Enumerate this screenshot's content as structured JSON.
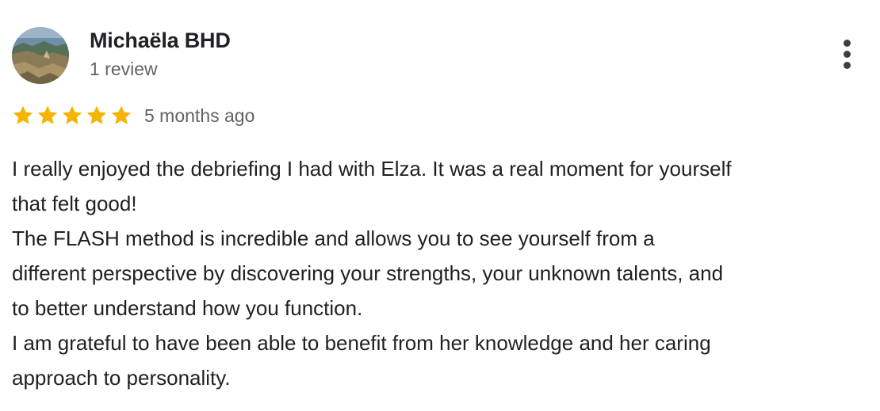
{
  "author": {
    "name": "Michaëla BHD",
    "review_count": "1 review"
  },
  "menu": {
    "icon": "more-vert-icon"
  },
  "rating": {
    "stars": 5,
    "max": 5,
    "color": "#f4b400"
  },
  "review": {
    "date": "5 months ago",
    "lines": [
      "I really enjoyed the debriefing I had with Elza. It was a real moment for yourself",
      "that felt good!",
      "The FLASH method is incredible and allows you to see yourself from a",
      "different perspective by discovering your strengths, your unknown talents, and",
      "to better understand how you function.",
      "I am grateful to have been able to benefit from her knowledge and her caring",
      "approach to personality."
    ]
  }
}
